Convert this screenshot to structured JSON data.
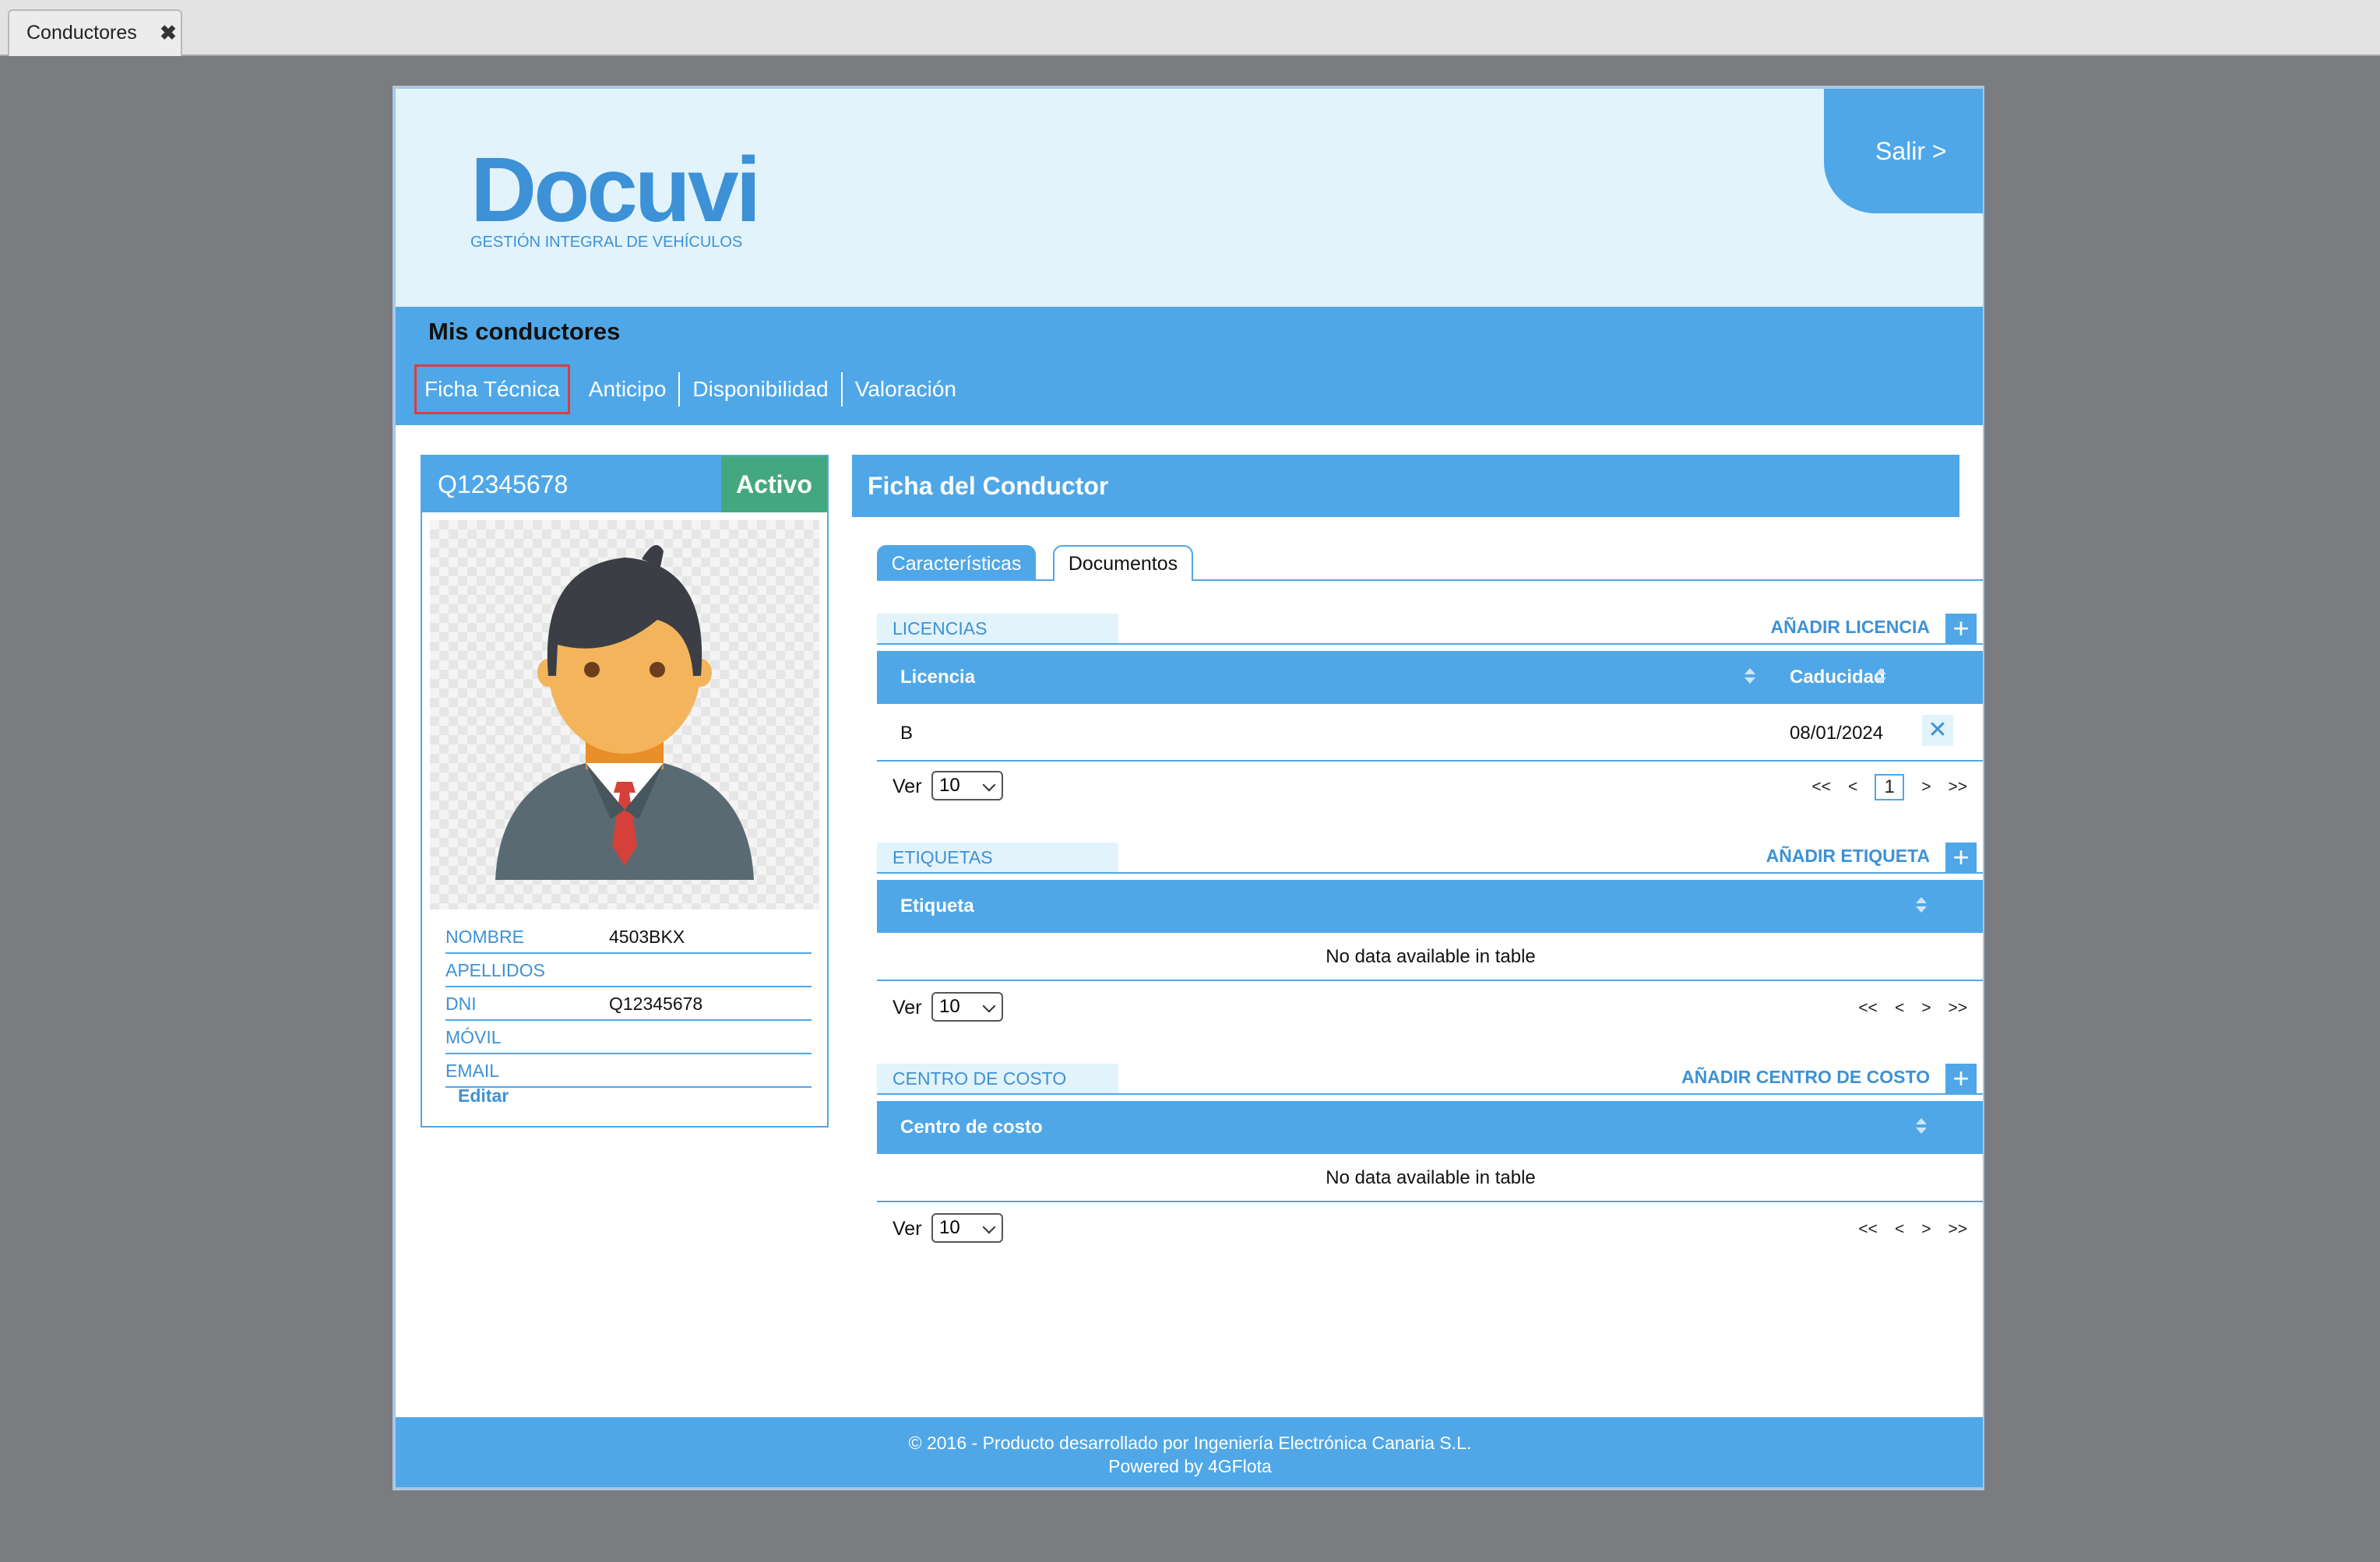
{
  "window": {
    "tab_label": "Conductores",
    "close_glyph": "✖"
  },
  "header": {
    "logo_word": "Docuvi",
    "logo_subtitle": "GESTIÓN INTEGRAL DE VEHÍCULOS",
    "logout_label": "Salir >"
  },
  "nav": {
    "title": "Mis conductores",
    "tabs": [
      {
        "label": "Ficha Técnica",
        "selected": true
      },
      {
        "label": "Anticipo"
      },
      {
        "label": "Disponibilidad"
      },
      {
        "label": "Valoración"
      }
    ]
  },
  "driver": {
    "id": "Q12345678",
    "status": "Activo",
    "status_color": "#43a882",
    "fields": [
      {
        "label": "NOMBRE",
        "value": "4503BKX"
      },
      {
        "label": "APELLIDOS",
        "value": ""
      },
      {
        "label": "DNI",
        "value": "Q12345678"
      },
      {
        "label": "MÓVIL",
        "value": ""
      },
      {
        "label": "EMAIL",
        "value": ""
      }
    ],
    "edit_label": "Editar"
  },
  "panel": {
    "title": "Ficha del Conductor",
    "tabs": [
      {
        "label": "Características",
        "active": true
      },
      {
        "label": "Documentos"
      }
    ]
  },
  "licencias": {
    "section_label": "LICENCIAS",
    "add_label": "AÑADIR LICENCIA",
    "add_glyph": "+",
    "columns": [
      "Licencia",
      "Caducidad"
    ],
    "rows": [
      {
        "licencia": "B",
        "caducidad": "08/01/2024",
        "delete_glyph": "✕"
      }
    ],
    "ver_label": "Ver",
    "page_size": "10",
    "pager": [
      "<<",
      "<",
      "1",
      ">",
      ">>"
    ]
  },
  "etiquetas": {
    "section_label": "ETIQUETAS",
    "add_label": "AÑADIR ETIQUETA",
    "add_glyph": "+",
    "columns": [
      "Etiqueta"
    ],
    "empty_text": "No data available in table",
    "ver_label": "Ver",
    "page_size": "10",
    "pager": [
      "<<",
      "<",
      ">",
      ">>"
    ]
  },
  "centro_costo": {
    "section_label": "CENTRO DE COSTO",
    "add_label": "AÑADIR CENTRO DE COSTO",
    "add_glyph": "+",
    "columns": [
      "Centro de costo"
    ],
    "empty_text": "No data available in table",
    "ver_label": "Ver",
    "page_size": "10",
    "pager": [
      "<<",
      "<",
      ">",
      ">>"
    ]
  },
  "footer": {
    "line1": "© 2016 - Producto desarrollado por Ingeniería Electrónica Canaria S.L.",
    "line2": "Powered by 4GFlota"
  },
  "colors": {
    "primary": "#4fa7e8",
    "header_bg": "#e2f3fb",
    "active_badge": "#43a882",
    "selected_outline": "#e03c3c",
    "backdrop": "#7b7c80"
  }
}
